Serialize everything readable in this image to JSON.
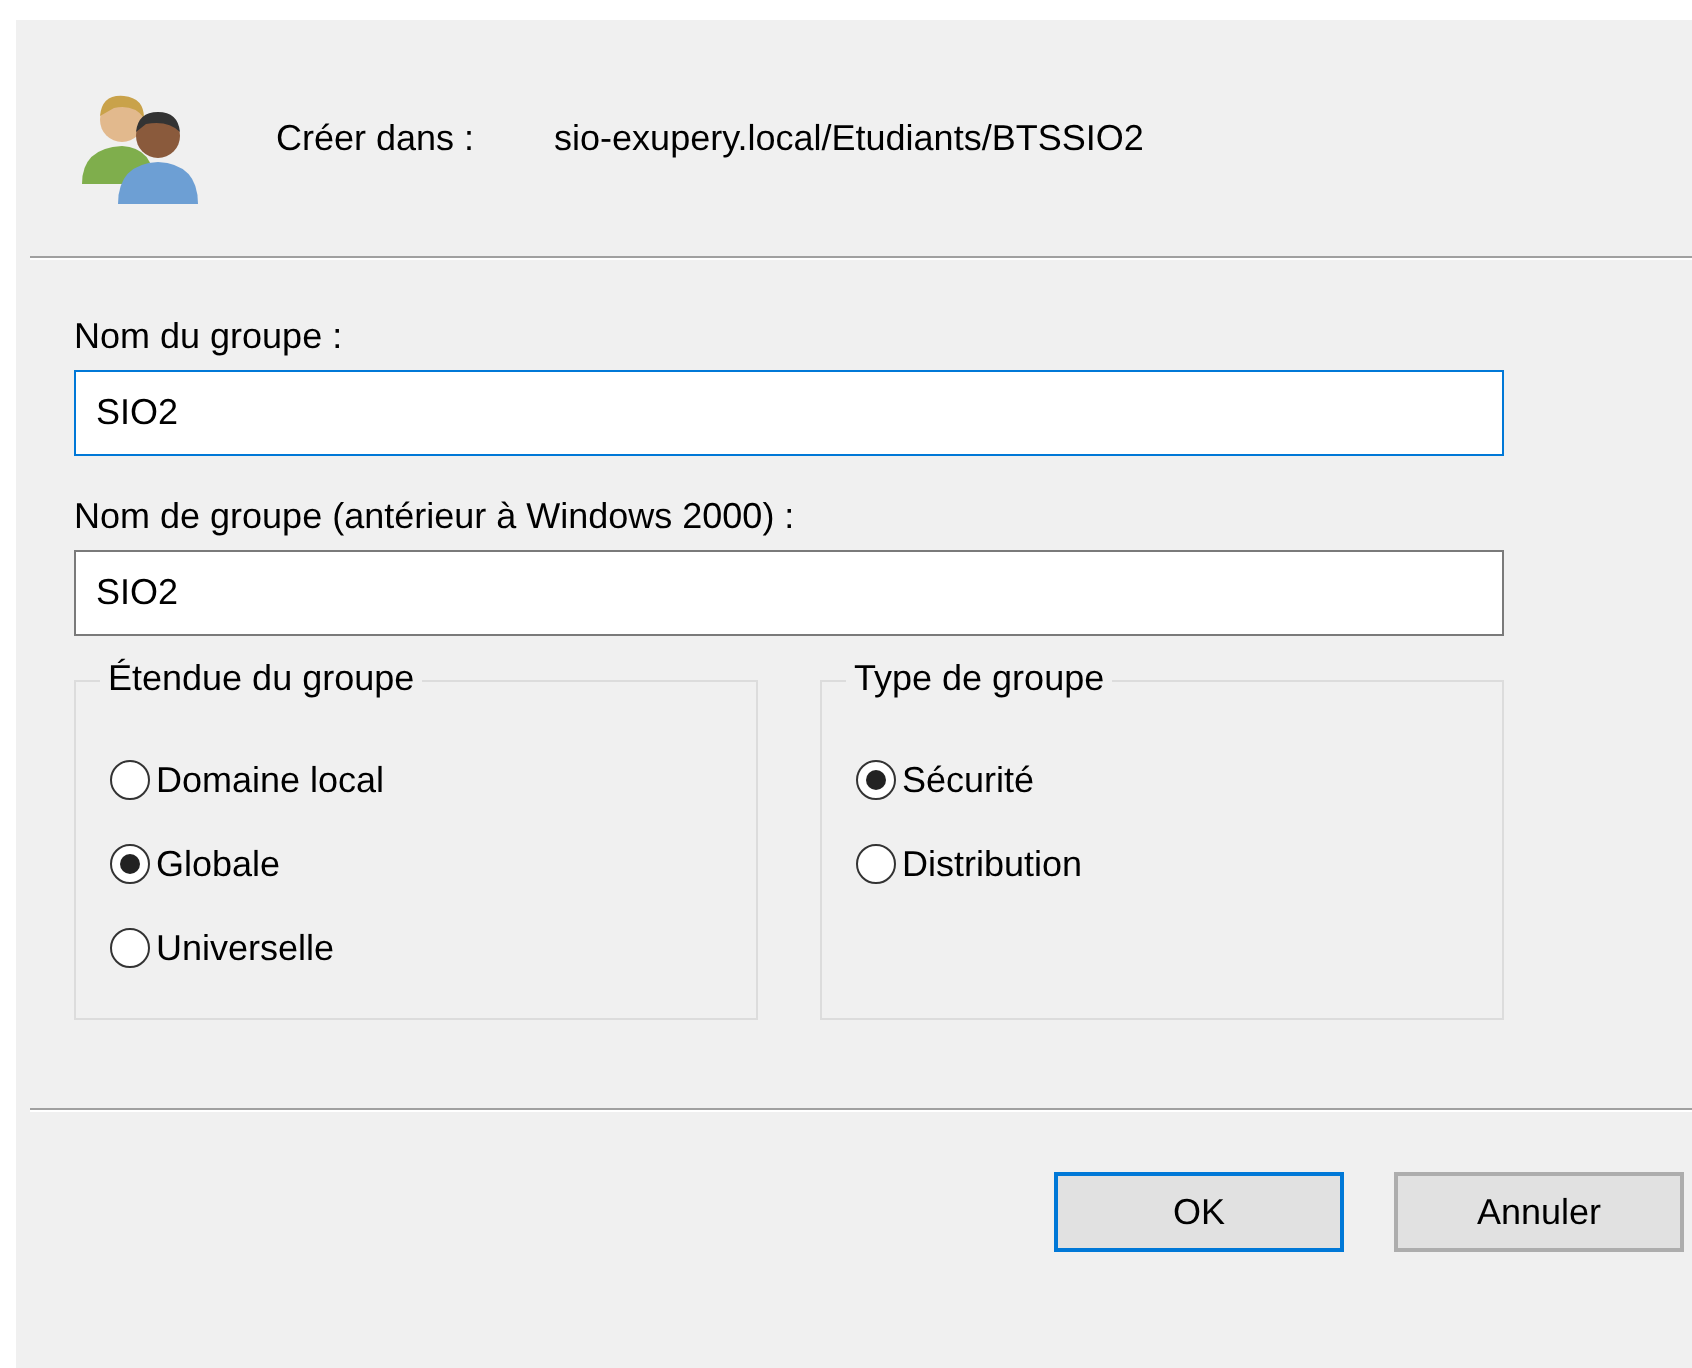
{
  "header": {
    "label": "Créer dans :",
    "path": "sio-exupery.local/Etudiants/BTSSIO2"
  },
  "fields": [
    {
      "label": "Nom du groupe :",
      "value": "SIO2",
      "focused": true
    },
    {
      "label": "Nom de groupe (antérieur à Windows 2000) :",
      "value": "SIO2",
      "focused": false
    }
  ],
  "groups": [
    {
      "title": "Étendue du groupe",
      "options": [
        {
          "label": "Domaine local",
          "selected": false
        },
        {
          "label": "Globale",
          "selected": true
        },
        {
          "label": "Universelle",
          "selected": false
        }
      ]
    },
    {
      "title": "Type de groupe",
      "options": [
        {
          "label": "Sécurité",
          "selected": true
        },
        {
          "label": "Distribution",
          "selected": false
        }
      ]
    }
  ],
  "buttons": [
    {
      "label": "OK",
      "default": true
    },
    {
      "label": "Annuler",
      "default": false
    }
  ]
}
